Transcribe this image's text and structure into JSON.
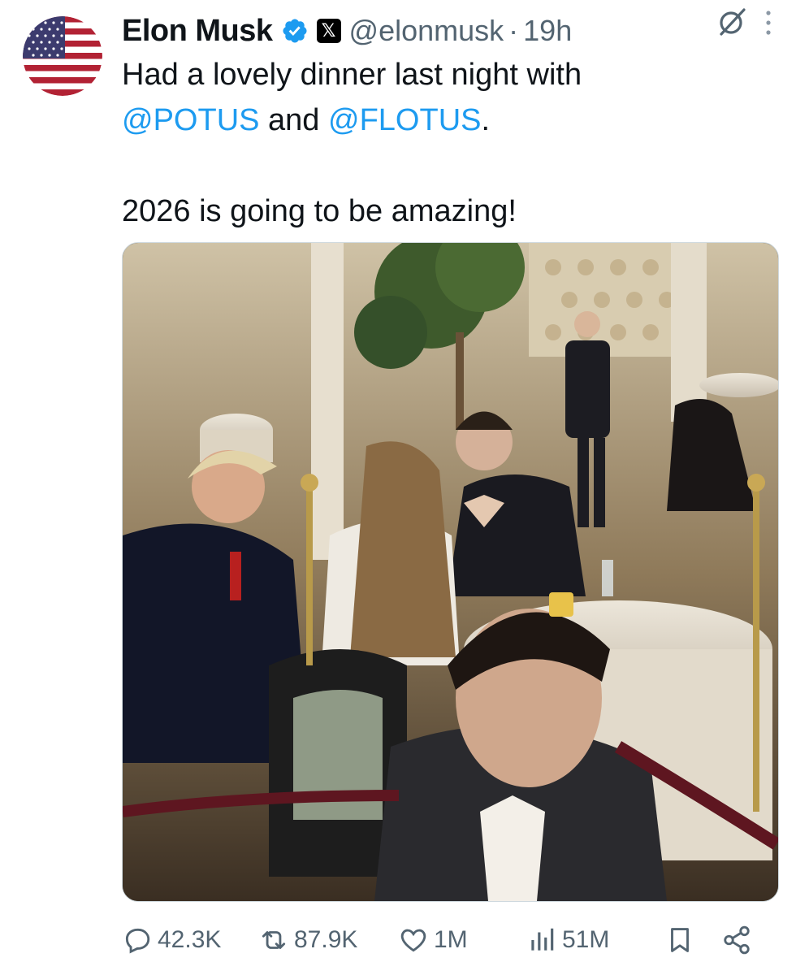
{
  "author": {
    "name": "Elon Musk",
    "handle": "@elonmusk",
    "separator": "·",
    "time": "19h",
    "x_badge": "𝕏"
  },
  "tweet": {
    "line1": "Had a lovely dinner last night with",
    "mention1": "@POTUS",
    "and_text": " and ",
    "mention2": "@FLOTUS",
    "period": ".",
    "line3": "2026 is going to be amazing!"
  },
  "stats": {
    "replies": "42.3K",
    "reposts": "87.9K",
    "likes": "1M",
    "views": "51M"
  },
  "icons": {
    "avatar": "us-flag-avatar",
    "verified": "verified-badge-icon",
    "x_affiliate": "x-logo-icon",
    "grok": "grok-icon",
    "more": "more-options-icon",
    "reply": "reply-icon",
    "repost": "repost-icon",
    "like": "heart-icon",
    "views": "views-bar-icon",
    "bookmark": "bookmark-icon",
    "share": "share-icon"
  },
  "colors": {
    "text": "#0f1419",
    "secondary": "#536471",
    "link": "#1d9bf0",
    "flag_red": "#b22234",
    "flag_blue": "#3c3b6e"
  }
}
